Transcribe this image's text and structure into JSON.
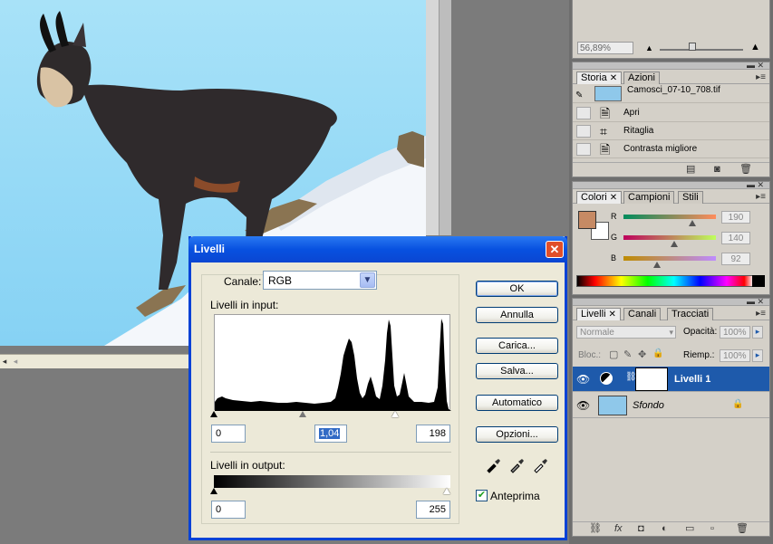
{
  "navigator": {
    "zoom": "56,89%"
  },
  "history": {
    "tabs": [
      "Storia",
      "Azioni"
    ],
    "snapshot": "Camosci_07-10_708.tif",
    "items": [
      "Apri",
      "Ritaglia",
      "Contrasta migliore"
    ]
  },
  "colors": {
    "tabs": [
      "Colori",
      "Campioni",
      "Stili"
    ],
    "foreground": "#c68a64",
    "channels": [
      {
        "label": "R",
        "value": "190"
      },
      {
        "label": "G",
        "value": "140"
      },
      {
        "label": "B",
        "value": "92"
      }
    ],
    "r_level": 190,
    "g_level": 140,
    "b_level": 92
  },
  "layers": {
    "tabs": [
      "Livelli",
      "Canali",
      "Tracciati"
    ],
    "blend_mode": "Normale",
    "opacity_label": "Opacità:",
    "opacity": "100%",
    "lock_label": "Bloc.:",
    "fill_label": "Riemp.:",
    "fill": "100%",
    "items": [
      {
        "name": "Livelli 1",
        "selected": true
      },
      {
        "name": "Sfondo",
        "selected": false
      }
    ]
  },
  "dialog": {
    "title": "Livelli",
    "channel_label": "Canale:",
    "channel": "RGB",
    "input_label": "Livelli in input:",
    "input_black": "0",
    "input_gamma": "1,04",
    "input_white": "198",
    "output_label": "Livelli in output:",
    "output_black": "0",
    "output_white": "255",
    "buttons": {
      "ok": "OK",
      "cancel": "Annulla",
      "load": "Carica...",
      "save": "Salva...",
      "auto": "Automatico",
      "options": "Opzioni..."
    },
    "preview_label": "Anteprima",
    "preview_checked": true
  },
  "icons": {
    "close": "close-icon",
    "dropdown": "chevron-down-icon",
    "eye": "eye-icon",
    "lock": "lock-icon",
    "eyedropper": "eyedropper-icon"
  }
}
